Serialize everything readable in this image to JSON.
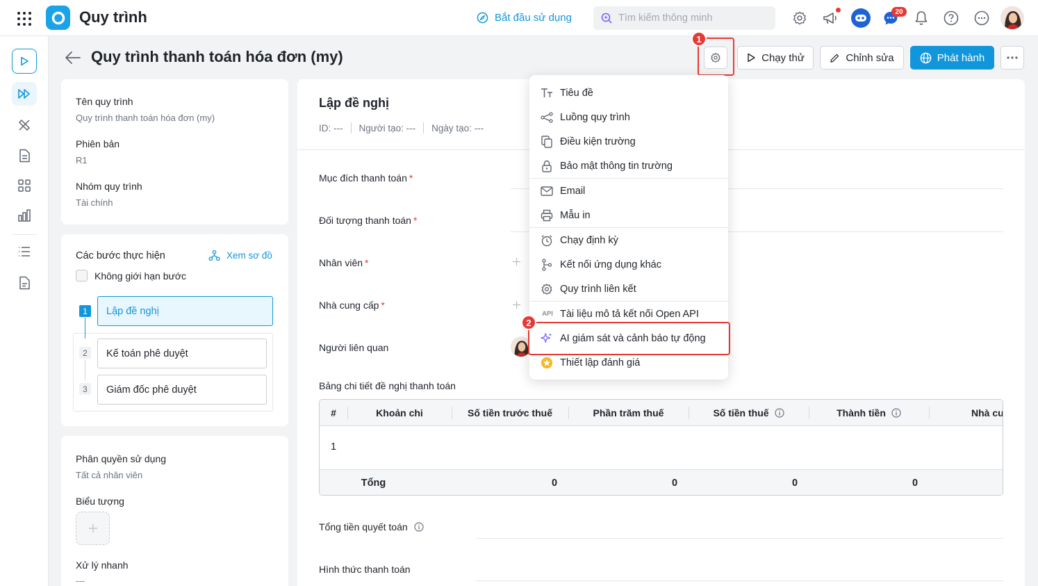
{
  "app": {
    "title": "Quy trình"
  },
  "header": {
    "getting_started": "Bắt đầu sử dụng",
    "search_placeholder": "Tìm kiếm thông minh",
    "chat_badge": "20"
  },
  "page": {
    "title": "Quy trình thanh toán hóa đơn (my)",
    "run_label": "Chạy thử",
    "edit_label": "Chỉnh sửa",
    "publish_label": "Phát hành",
    "callout_1": "1",
    "callout_2": "2"
  },
  "info": {
    "name_label": "Tên quy trình",
    "name_value": "Quy trình thanh toán hóa đơn (my)",
    "version_label": "Phiên bản",
    "version_value": "R1",
    "group_label": "Nhóm quy trình",
    "group_value": "Tài chính"
  },
  "steps": {
    "title": "Các bước thực hiện",
    "diagram_link": "Xem sơ đồ",
    "unlimited_label": "Không giới hạn bước",
    "items": [
      {
        "num": "1",
        "label": "Lập đề nghị"
      },
      {
        "num": "2",
        "label": "Kế toán phê duyệt"
      },
      {
        "num": "3",
        "label": "Giám đốc phê duyệt"
      }
    ]
  },
  "permissions": {
    "label": "Phân quyền sử dụng",
    "value": "Tất cả nhân viên",
    "icon_label": "Biểu tượng",
    "quick_label": "Xử lý nhanh",
    "quick_value": "---"
  },
  "form": {
    "step_title": "Lập đề nghị",
    "id_label": "ID: ---",
    "creator_label": "Người tạo: ---",
    "date_label": "Ngày tạo: ---",
    "fields": [
      "Mục đích thanh toán",
      "Đối tượng thanh toán",
      "Nhân viên",
      "Nhà cung cấp",
      "Người liên quan"
    ],
    "table_title": "Bảng chi tiết đề nghị thanh toán",
    "table_headers": [
      "#",
      "Khoản chi",
      "Số tiền trước thuế",
      "Phần trăm thuế",
      "Số tiền thuế",
      "Thành tiền",
      "Nhà cu"
    ],
    "row_num": "1",
    "total_label": "Tổng",
    "totals": [
      "0",
      "0",
      "0",
      "0"
    ],
    "settlement_label": "Tổng tiền quyết toán",
    "method_label": "Hình thức thanh toán"
  },
  "menu": {
    "items": [
      {
        "label": "Tiêu đề",
        "icon": "text-format-icon"
      },
      {
        "label": "Luồng quy trình",
        "icon": "flow-icon"
      },
      {
        "label": "Điều kiện trường",
        "icon": "copy-icon"
      },
      {
        "label": "Bảo mật thông tin trường",
        "icon": "lock-icon"
      },
      {
        "label": "Email",
        "icon": "mail-icon"
      },
      {
        "label": "Mẫu in",
        "icon": "printer-icon"
      },
      {
        "label": "Chạy định kỳ",
        "icon": "alarm-icon"
      },
      {
        "label": "Kết nối ứng dụng khác",
        "icon": "branch-icon"
      },
      {
        "label": "Quy trình liên kết",
        "icon": "gear-link-icon"
      },
      {
        "label": "Tài liệu mô tả kết nối Open API",
        "icon": "api-icon"
      },
      {
        "label": "AI giám sát và cảnh báo tự động",
        "icon": "sparkle-icon"
      },
      {
        "label": "Thiết lập đánh giá",
        "icon": "star-badge-icon"
      }
    ],
    "api_text": "API"
  },
  "colors": {
    "accent": "#1296db",
    "callout": "#e53935",
    "active_step_bg": "#e8f6fd"
  }
}
